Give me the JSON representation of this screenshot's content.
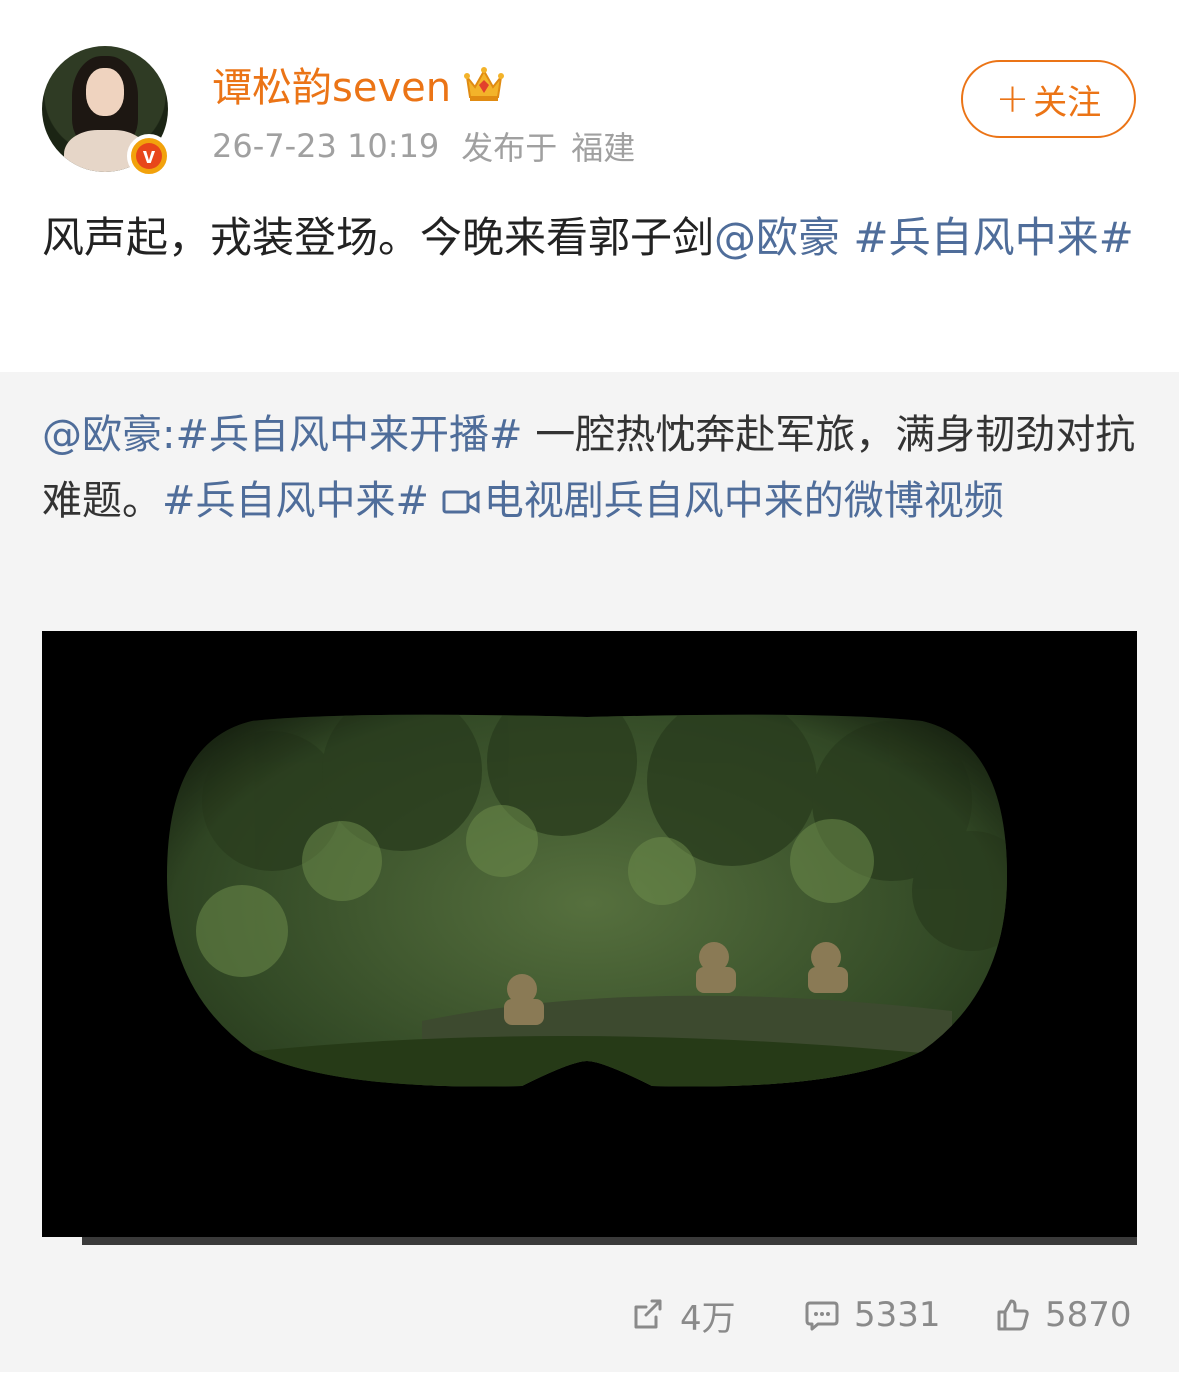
{
  "post": {
    "author": {
      "name": "谭松韵seven",
      "avatar_alt": "avatar",
      "badge_letter": "v",
      "crown_icon": "crown-icon"
    },
    "time": "26-7-23 10:19",
    "location_label": "发布于",
    "location": "福建",
    "follow_button": {
      "plus": "+",
      "label": "关注"
    },
    "text_plain": "风声起，戎装登场。今晚来看郭子剑",
    "mention": "@欧豪",
    "hashtag": "#兵自风中来#"
  },
  "repost": {
    "mention": "@欧豪:",
    "hashtag_1": "#兵自风中来开播#",
    "text_1": " 一腔热忱奔赴军旅，满身韧劲对抗难题。",
    "hashtag_2": "#兵自风中来#",
    "video_link_label": "电视剧兵自风中来的微博视频",
    "video_icon": "video-camera-icon"
  },
  "actions": {
    "repost_count": "4万",
    "comment_count": "5331",
    "like_count": "5870"
  },
  "colors": {
    "accent": "#eb7416",
    "link": "#4f6d9a",
    "muted": "#a0a0a0",
    "repost_bg": "#f4f4f4"
  }
}
